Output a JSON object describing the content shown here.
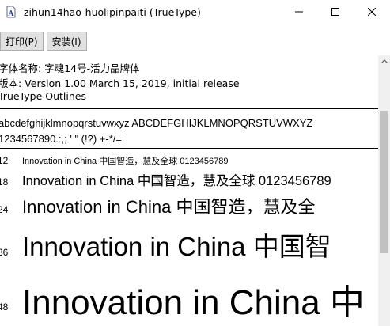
{
  "window": {
    "title": "zihun14hao-huolipinpaiti (TrueType)"
  },
  "toolbar": {
    "print_label": "打印(P)",
    "install_label": "安装(I)"
  },
  "font_info": {
    "name_line": "字体名称: 字魂14号-活力品牌体",
    "version_line": "版本: Version 1.00 March 15, 2019, initial release",
    "outline_line": "TrueType Outlines"
  },
  "samples": {
    "alphabet": "abcdefghijklmnopqrstuvwxyz ABCDEFGHIJKLMNOPQRSTUVWXYZ",
    "digits": "1234567890.:,; ' \" (!?) +-*/="
  },
  "size_rows": [
    {
      "size": "12",
      "text": "Innovation in China 中国智造，慧及全球 0123456789"
    },
    {
      "size": "18",
      "text": "Innovation in China 中国智造，慧及全球 0123456789"
    },
    {
      "size": "24",
      "text": "Innovation in China 中国智造，慧及全"
    },
    {
      "size": "36",
      "text": "Innovation in China 中国智"
    },
    {
      "size": "48",
      "text": "Innovation in China 中"
    }
  ],
  "icons": {
    "app": "font-file-icon",
    "minimize": "minimize-icon",
    "maximize": "maximize-icon",
    "close": "close-icon"
  }
}
